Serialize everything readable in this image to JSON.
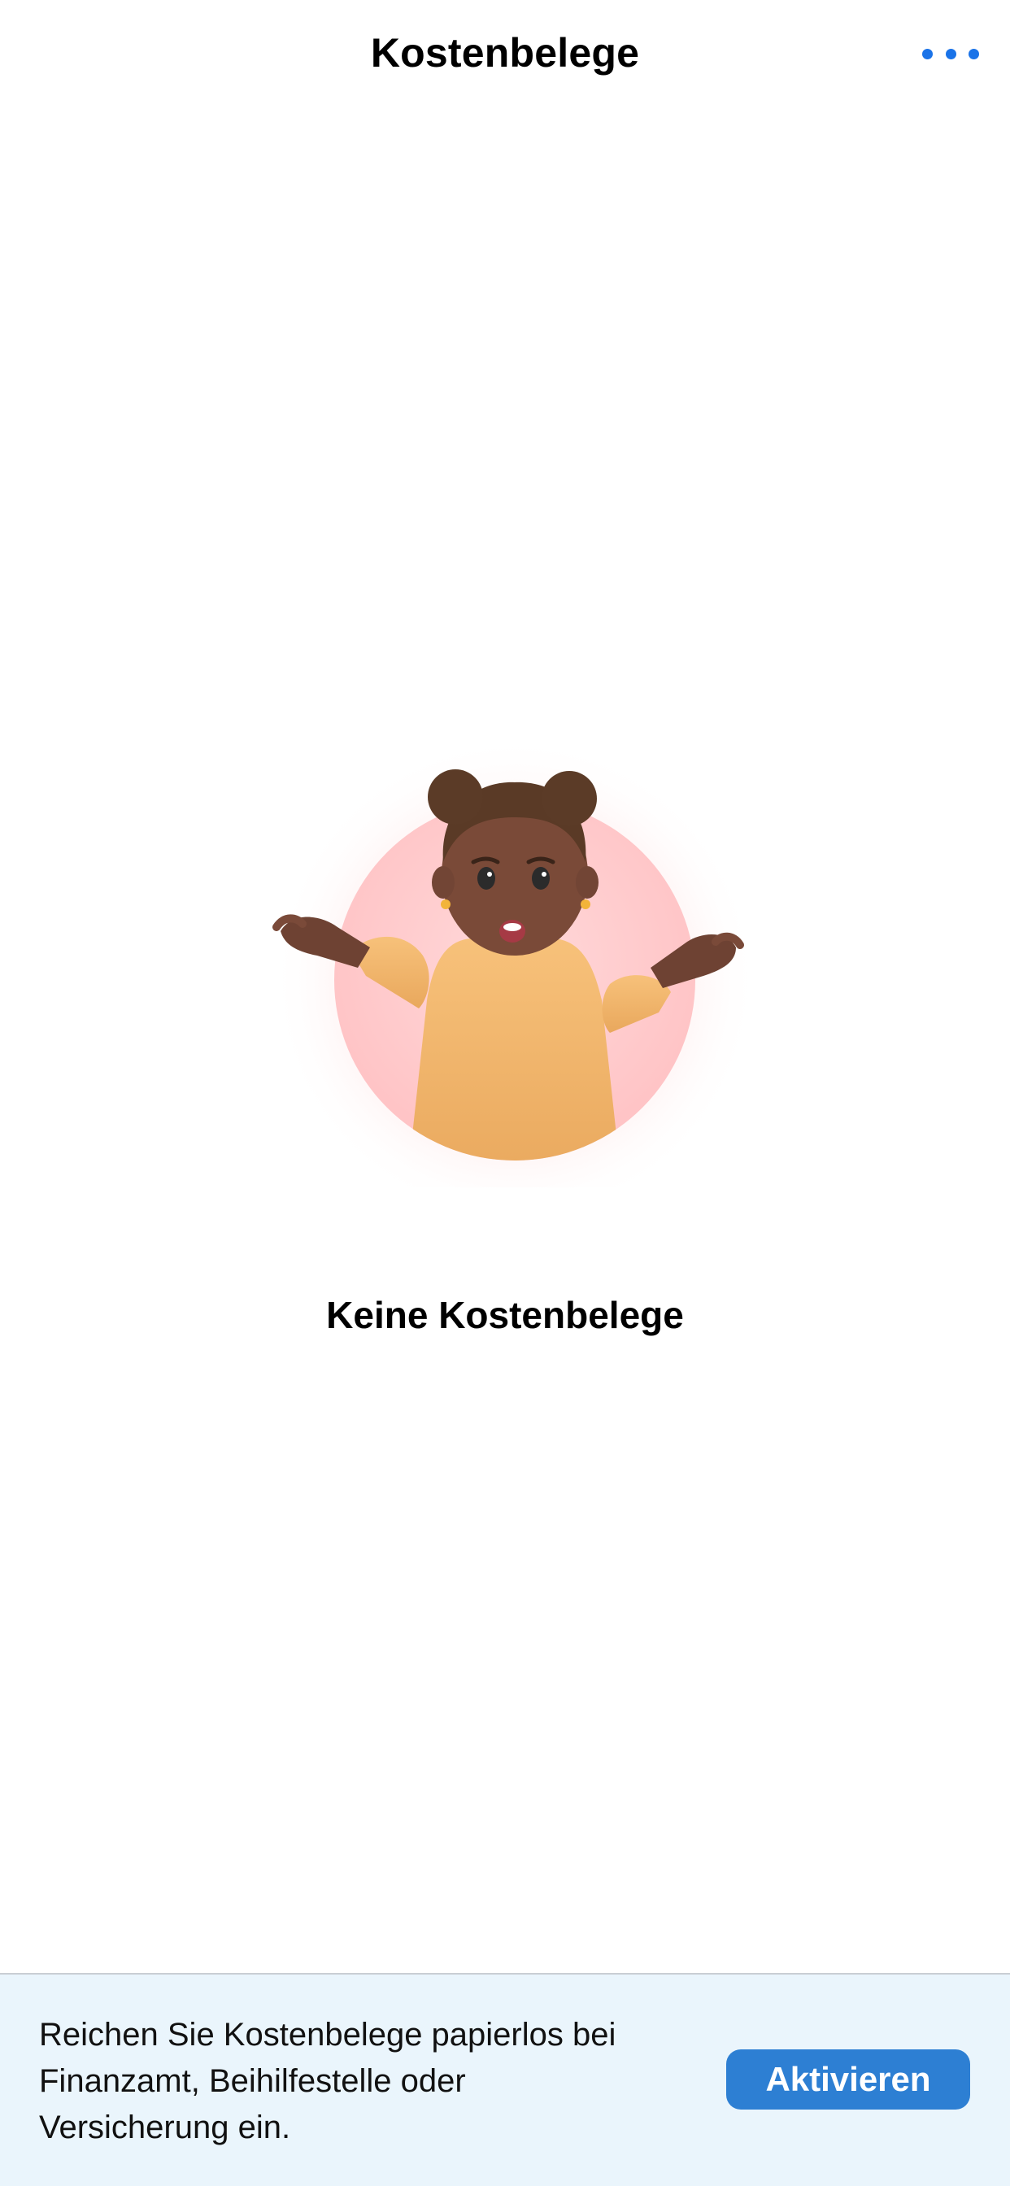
{
  "header": {
    "title": "Kostenbelege",
    "more_icon": "more-horizontal-icon",
    "accent_color": "#1a73e8"
  },
  "empty_state": {
    "illustration": "shrugging-person-illustration",
    "title": "Keine Kostenbelege"
  },
  "banner": {
    "text": "Reichen Sie Kostenbelege papierlos bei Finanzamt, Beihilfestelle oder Versicherung ein.",
    "button_label": "Aktivieren",
    "button_color": "#2d7fd3",
    "background_color": "#eaf5fc"
  }
}
